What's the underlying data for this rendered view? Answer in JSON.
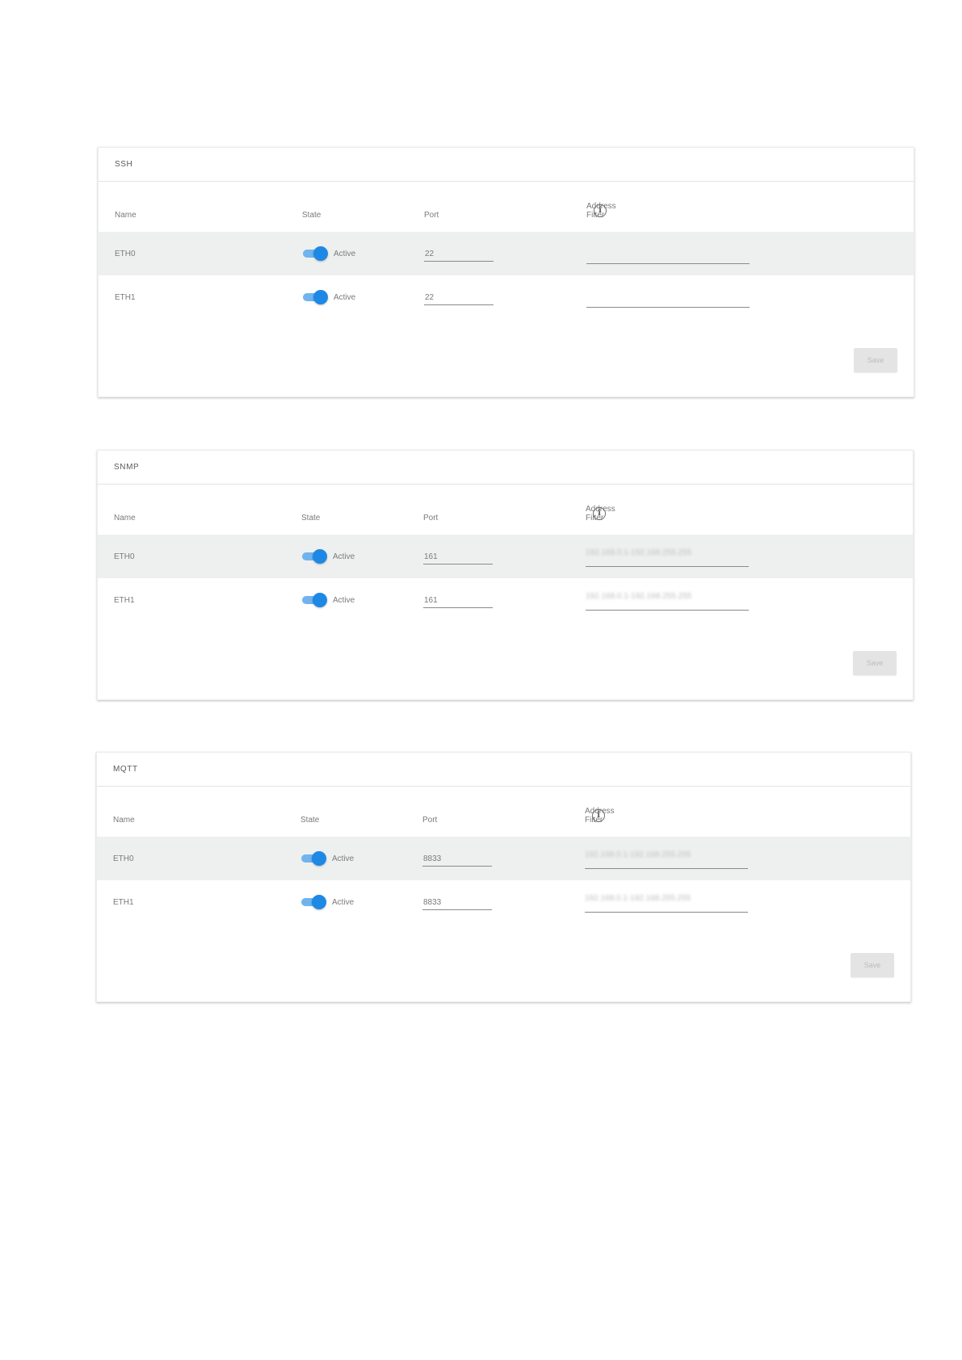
{
  "columns": {
    "name": "Name",
    "state": "State",
    "port": "Port",
    "address_filter": "Address Filter"
  },
  "icons": {
    "info": "info-circle-icon"
  },
  "colors": {
    "toggle_active": "#1e88e5",
    "toggle_track": "#6fb4ee",
    "row_shade": "#eef0ef"
  },
  "save_label": "Save",
  "sections": [
    {
      "title": "SSH",
      "rows": [
        {
          "name": "ETH0",
          "state": "Active",
          "port": "22",
          "address_filter": ""
        },
        {
          "name": "ETH1",
          "state": "Active",
          "port": "22",
          "address_filter": ""
        }
      ]
    },
    {
      "title": "SNMP",
      "rows": [
        {
          "name": "ETH0",
          "state": "Active",
          "port": "161",
          "address_filter": "192.168.0.1-192.168.255.255"
        },
        {
          "name": "ETH1",
          "state": "Active",
          "port": "161",
          "address_filter": "192.168.0.1-192.168.255.255"
        }
      ]
    },
    {
      "title": "MQTT",
      "rows": [
        {
          "name": "ETH0",
          "state": "Active",
          "port": "8833",
          "address_filter": "192.168.0.1-192.168.255.255"
        },
        {
          "name": "ETH1",
          "state": "Active",
          "port": "8833",
          "address_filter": "192.168.0.1-192.168.255.255"
        }
      ]
    }
  ]
}
